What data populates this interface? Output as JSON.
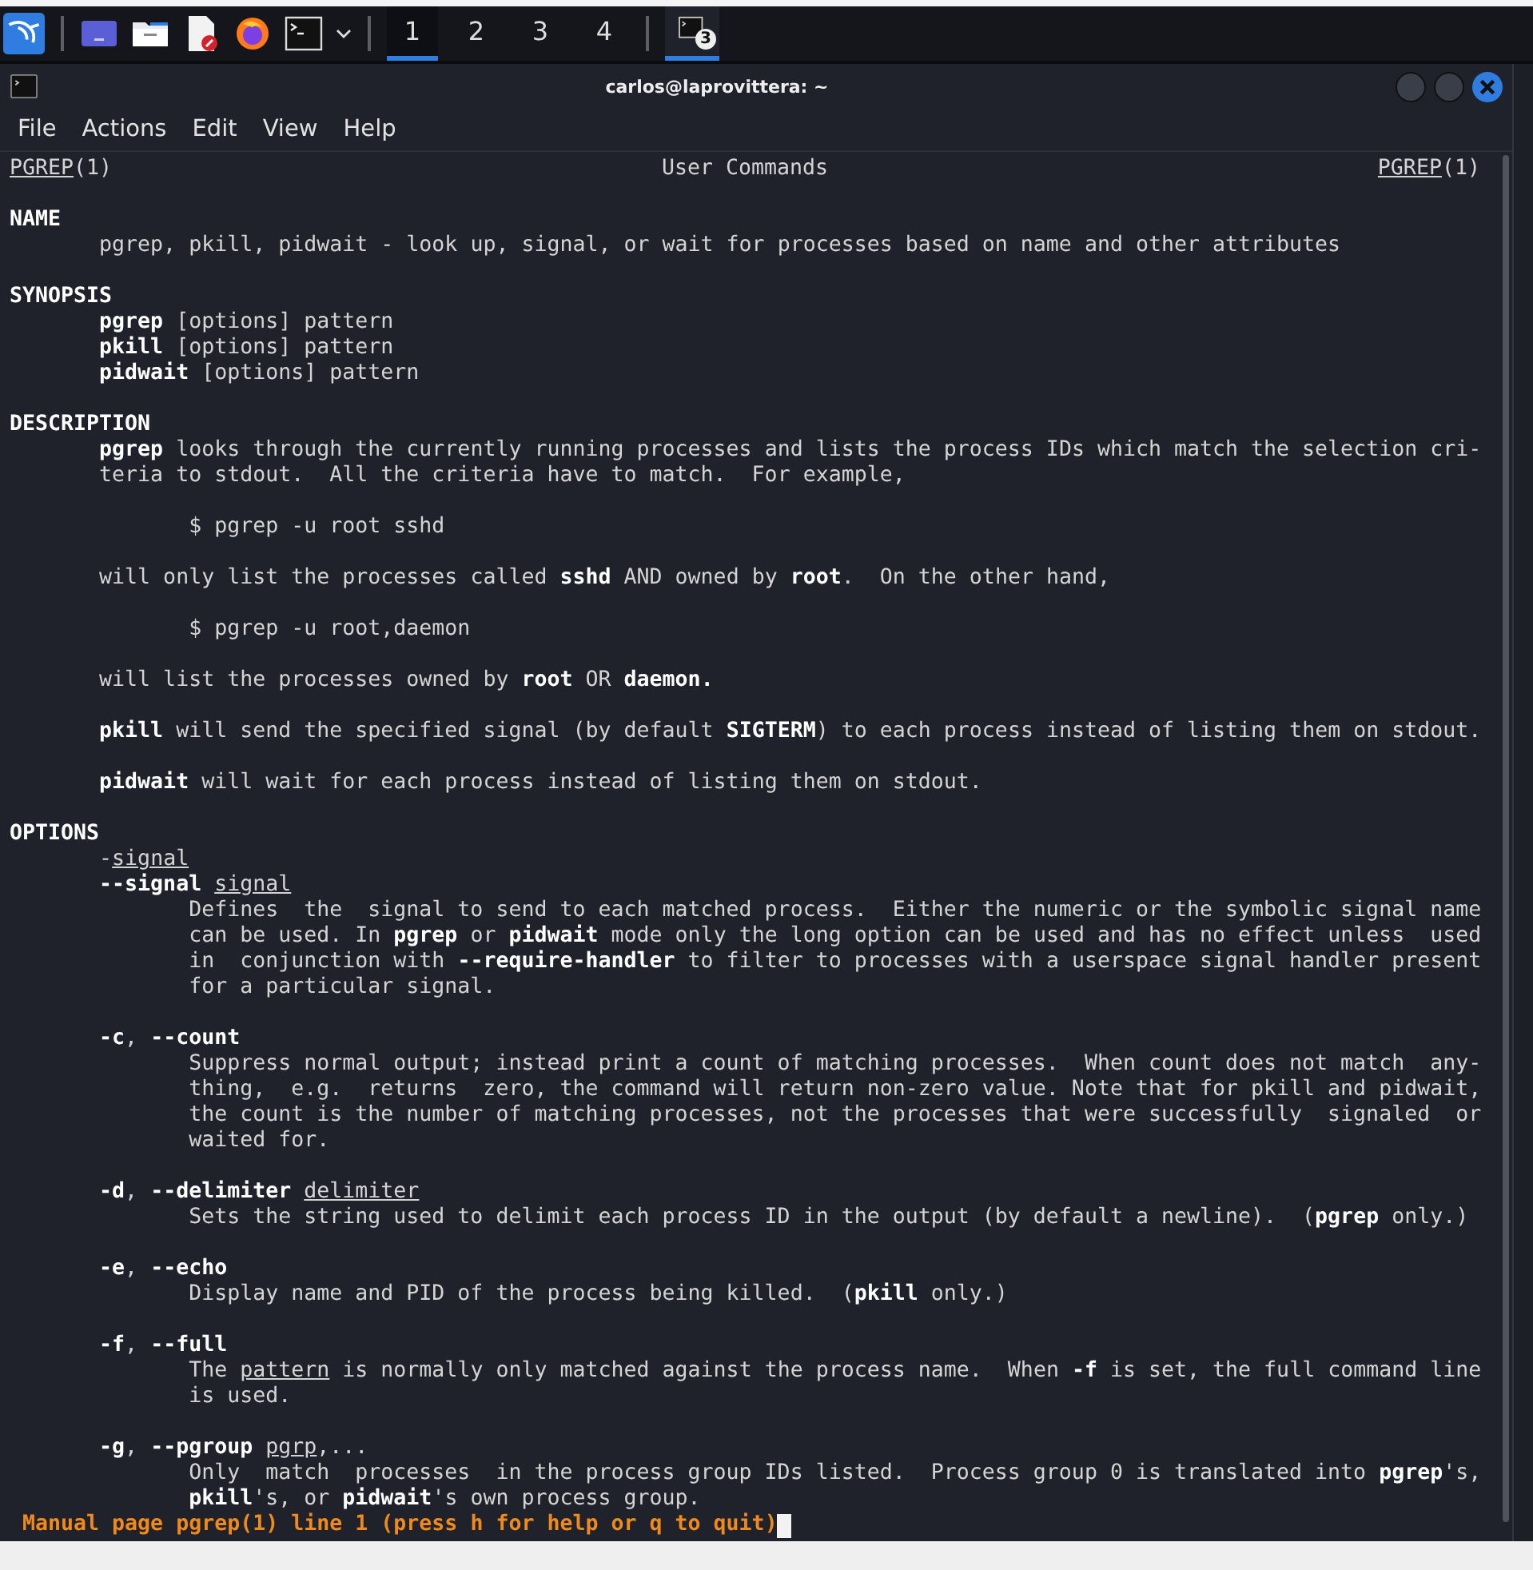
{
  "taskbar": {
    "workspaces": [
      {
        "label": "1",
        "selected": true
      },
      {
        "label": "2",
        "selected": false
      },
      {
        "label": "3",
        "selected": false
      },
      {
        "label": "4",
        "selected": false
      }
    ],
    "tasks": [
      {
        "badge": "3",
        "selected": true
      }
    ]
  },
  "window": {
    "title": "carlos@laprovittera: ~"
  },
  "menu": [
    "File",
    "Actions",
    "Edit",
    "View",
    "Help"
  ],
  "man_header": {
    "left": "*PGREP*(1)",
    "center": "User Commands",
    "right": "*PGREP*(1)"
  },
  "lines": [
    {
      "kind": "blank"
    },
    {
      "kind": "heading",
      "text": "NAME"
    },
    {
      "kind": "text",
      "text": "pgrep, pkill, pidwait - look up, signal, or wait for processes based on name and other attributes"
    },
    {
      "kind": "blank"
    },
    {
      "kind": "heading",
      "text": "SYNOPSIS"
    },
    {
      "kind": "text",
      "text": "**pgrep** [options] pattern"
    },
    {
      "kind": "text",
      "text": "**pkill** [options] pattern"
    },
    {
      "kind": "text",
      "text": "**pidwait** [options] pattern"
    },
    {
      "kind": "blank"
    },
    {
      "kind": "heading",
      "text": "DESCRIPTION"
    },
    {
      "kind": "text",
      "text": "**pgrep** looks through the currently running processes and lists the process IDs which match the selection cri-"
    },
    {
      "kind": "text",
      "text": "teria to stdout.  All the criteria have to match.  For example,"
    },
    {
      "kind": "blank"
    },
    {
      "kind": "example",
      "text": "$ pgrep -u root sshd"
    },
    {
      "kind": "blank"
    },
    {
      "kind": "text",
      "text": "will only list the processes called **sshd** AND owned by **root**.  On the other hand,"
    },
    {
      "kind": "blank"
    },
    {
      "kind": "example",
      "text": "$ pgrep -u root,daemon"
    },
    {
      "kind": "blank"
    },
    {
      "kind": "text",
      "text": "will list the processes owned by **root** OR **daemon.**"
    },
    {
      "kind": "blank"
    },
    {
      "kind": "text",
      "text": "**pkill** will send the specified signal (by default **SIGTERM**) to each process instead of listing them on stdout."
    },
    {
      "kind": "blank"
    },
    {
      "kind": "text",
      "text": "**pidwait** will wait for each process instead of listing them on stdout."
    },
    {
      "kind": "blank"
    },
    {
      "kind": "heading",
      "text": "OPTIONS"
    },
    {
      "kind": "option",
      "text": "-*signal*"
    },
    {
      "kind": "option",
      "text": "**--signal** *signal*"
    },
    {
      "kind": "desc",
      "text": "Defines  the  signal to send to each matched process.  Either the numeric or the symbolic signal name"
    },
    {
      "kind": "desc",
      "text": "can be used. In **pgrep** or **pidwait** mode only the long option can be used and has no effect unless  used"
    },
    {
      "kind": "desc",
      "text": "in  conjunction with **--require-handler** to filter to processes with a userspace signal handler present"
    },
    {
      "kind": "desc",
      "text": "for a particular signal."
    },
    {
      "kind": "blank"
    },
    {
      "kind": "option",
      "text": "**-c**, **--count**"
    },
    {
      "kind": "desc",
      "text": "Suppress normal output; instead print a count of matching processes.  When count does not match  any-"
    },
    {
      "kind": "desc",
      "text": "thing,  e.g.  returns  zero, the command will return non-zero value. Note that for pkill and pidwait,"
    },
    {
      "kind": "desc",
      "text": "the count is the number of matching processes, not the processes that were successfully  signaled  or"
    },
    {
      "kind": "desc",
      "text": "waited for."
    },
    {
      "kind": "blank"
    },
    {
      "kind": "option",
      "text": "**-d**, **--delimiter** *delimiter*"
    },
    {
      "kind": "desc",
      "text": "Sets the string used to delimit each process ID in the output (by default a newline).  (**pgrep** only.)"
    },
    {
      "kind": "blank"
    },
    {
      "kind": "option",
      "text": "**-e**, **--echo**"
    },
    {
      "kind": "desc",
      "text": "Display name and PID of the process being killed.  (**pkill** only.)"
    },
    {
      "kind": "blank"
    },
    {
      "kind": "option",
      "text": "**-f**, **--full**"
    },
    {
      "kind": "desc",
      "text": "The *pattern* is normally only matched against the process name.  When **-f** is set, the full command line"
    },
    {
      "kind": "desc",
      "text": "is used."
    },
    {
      "kind": "blank"
    },
    {
      "kind": "option",
      "text": "**-g**, **--pgroup** *pgrp*,..."
    },
    {
      "kind": "desc",
      "text": "Only  match  processes  in the process group IDs listed.  Process group 0 is translated into **pgrep**'s,"
    },
    {
      "kind": "desc",
      "text": "**pkill**'s, or **pidwait**'s own process group."
    }
  ],
  "status_line": "Manual page pgrep(1) line 1 (press h for help or q to quit)"
}
